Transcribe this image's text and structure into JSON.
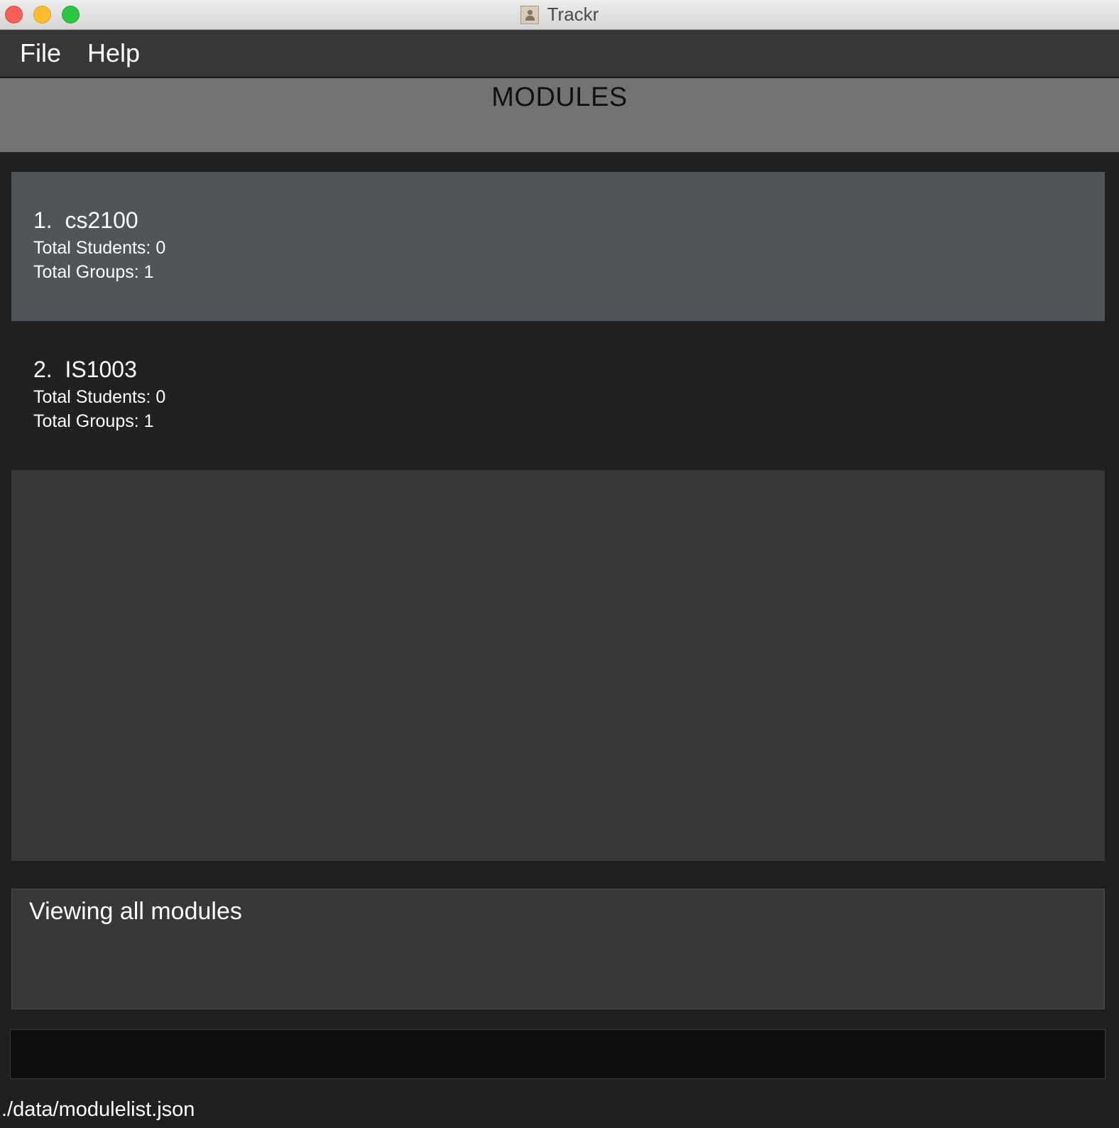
{
  "window": {
    "title": "Trackr"
  },
  "menu": {
    "items": [
      {
        "label": "File"
      },
      {
        "label": "Help"
      }
    ]
  },
  "header": {
    "title": "MODULES"
  },
  "modules": [
    {
      "index": "1.",
      "code": "cs2100",
      "students": "Total Students: 0",
      "groups": "Total Groups: 1",
      "selected": true
    },
    {
      "index": "2.",
      "code": "IS1003",
      "students": "Total Students: 0",
      "groups": "Total Groups: 1",
      "selected": false
    }
  ],
  "result": {
    "text": "Viewing all modules"
  },
  "command": {
    "value": ""
  },
  "status": {
    "path": "./data/modulelist.json"
  },
  "colors": {
    "selected_card": "#505559",
    "card": "#212121",
    "list_bg": "#383838",
    "header_bg": "#737373",
    "menubar_bg": "#373737",
    "command_bg": "#0f0f0f"
  }
}
